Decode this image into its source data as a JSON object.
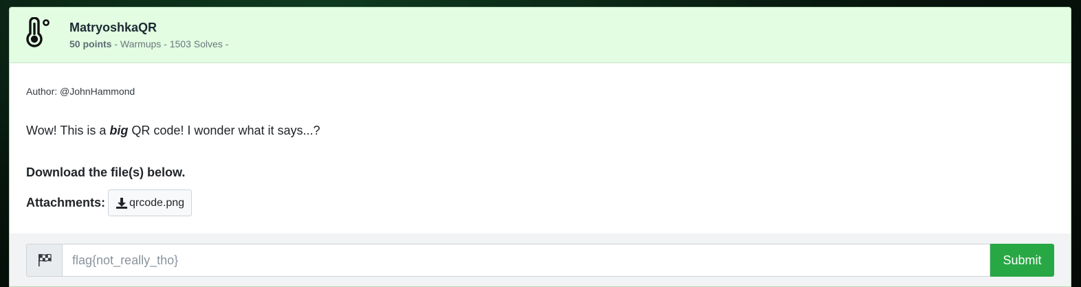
{
  "challenge": {
    "icon": "thermometer-degree-icon",
    "title": "MatryoshkaQR",
    "points": "50 points",
    "meta": " - Warmups - 1503 Solves -"
  },
  "body": {
    "author": "Author: @JohnHammond",
    "desc_before": "Wow! This is a ",
    "desc_emphasis": "big",
    "desc_after": " QR code! I wonder what it says...?",
    "download_heading": "Download the file(s) below.",
    "attachments_label": "Attachments:",
    "attachments": [
      {
        "name": "qrcode.png",
        "icon": "download-icon"
      }
    ]
  },
  "flag_form": {
    "addon_icon": "checkered-flag-icon",
    "placeholder": "flag{not_really_tho}",
    "value": "",
    "submit_label": "Submit"
  },
  "colors": {
    "header_bg": "#e2fde2",
    "submit_bg": "#28a745",
    "page_bg": "#07140c"
  }
}
